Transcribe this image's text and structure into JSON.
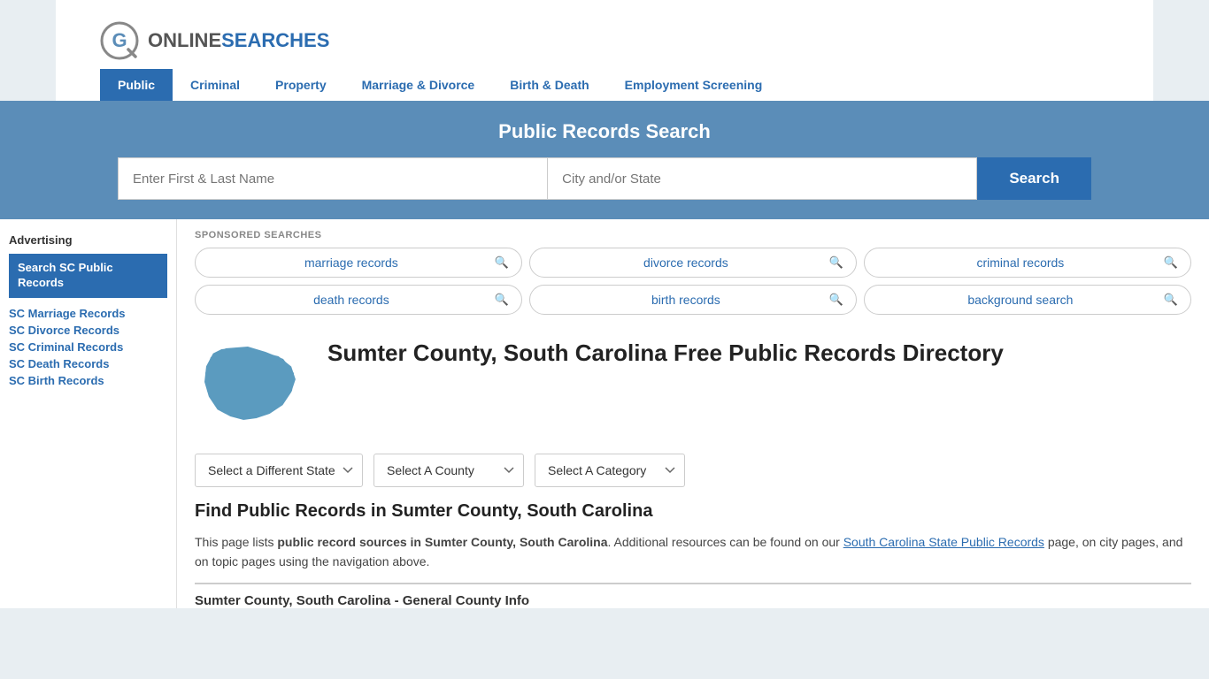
{
  "site": {
    "logo_online": "ONLINE",
    "logo_searches": "SEARCHES"
  },
  "nav": {
    "items": [
      {
        "label": "Public",
        "active": true
      },
      {
        "label": "Criminal",
        "active": false
      },
      {
        "label": "Property",
        "active": false
      },
      {
        "label": "Marriage & Divorce",
        "active": false
      },
      {
        "label": "Birth & Death",
        "active": false
      },
      {
        "label": "Employment Screening",
        "active": false
      }
    ]
  },
  "search_banner": {
    "title": "Public Records Search",
    "name_placeholder": "Enter First & Last Name",
    "city_placeholder": "City and/or State",
    "search_button": "Search"
  },
  "sponsored": {
    "label": "SPONSORED SEARCHES",
    "pills": [
      {
        "text": "marriage records"
      },
      {
        "text": "divorce records"
      },
      {
        "text": "criminal records"
      },
      {
        "text": "death records"
      },
      {
        "text": "birth records"
      },
      {
        "text": "background search"
      }
    ]
  },
  "page": {
    "title": "Sumter County, South Carolina Free Public Records Directory",
    "find_title": "Find Public Records in Sumter County, South Carolina",
    "find_text_1": "This page lists ",
    "find_bold": "public record sources in Sumter County, South Carolina",
    "find_text_2": ". Additional resources can be found on our ",
    "find_link": "South Carolina State Public Records",
    "find_text_3": " page, on city pages, and on topic pages using the navigation above.",
    "general_info_title": "Sumter County, South Carolina - General County Info"
  },
  "dropdowns": {
    "state": "Select a Different State",
    "county": "Select A County",
    "category": "Select A Category"
  },
  "sidebar": {
    "ad_label": "Advertising",
    "ad_button": "Search SC Public Records",
    "links": [
      "SC Marriage Records",
      "SC Divorce Records",
      "SC Criminal Records",
      "SC Death Records",
      "SC Birth Records"
    ]
  }
}
